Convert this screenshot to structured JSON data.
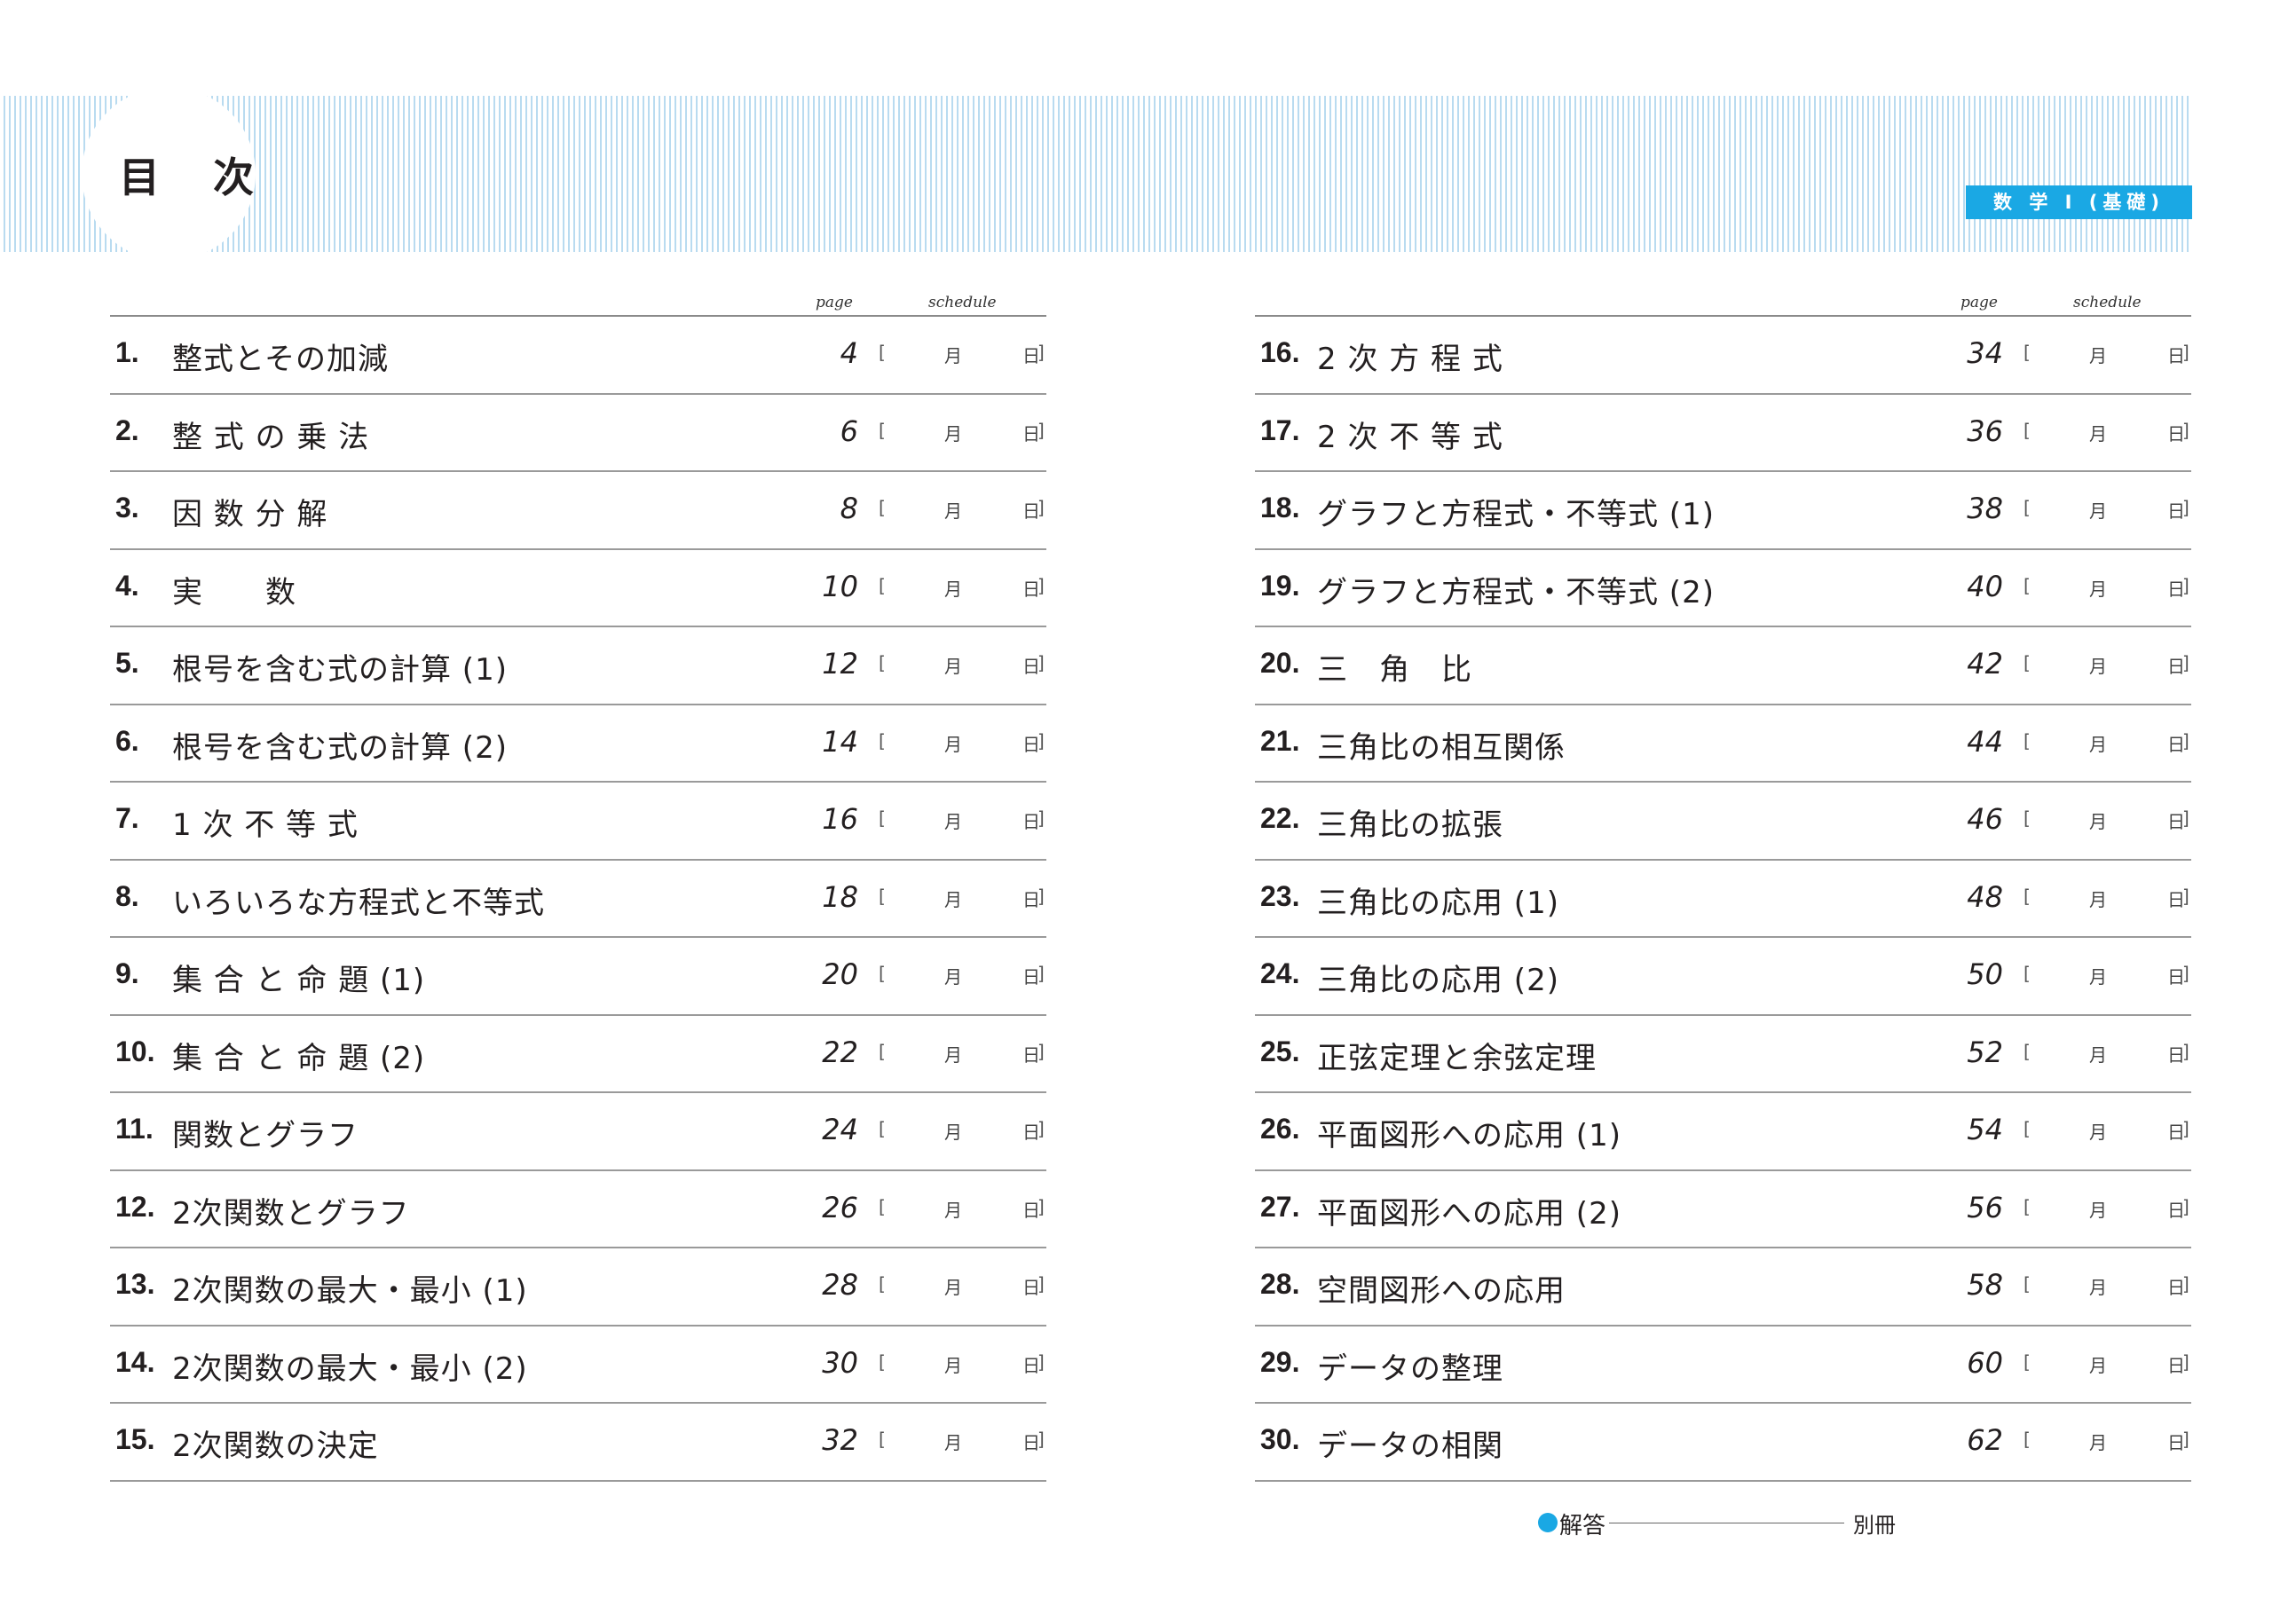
{
  "page_title": "目 次",
  "subject_badge": "数 学 I (基礎)",
  "headers": {
    "page": "page",
    "schedule": "schedule"
  },
  "schedule_labels": {
    "open": "[",
    "month": "月",
    "day": "日",
    "close": "]"
  },
  "left_items": [
    {
      "num": "1.",
      "title": "整式とその加減",
      "page": "4"
    },
    {
      "num": "2.",
      "title": "整 式 の 乗 法",
      "page": "6"
    },
    {
      "num": "3.",
      "title": "因 数 分 解",
      "page": "8"
    },
    {
      "num": "4.",
      "title": "実　　数",
      "page": "10"
    },
    {
      "num": "5.",
      "title": "根号を含む式の計算 (1)",
      "page": "12"
    },
    {
      "num": "6.",
      "title": "根号を含む式の計算 (2)",
      "page": "14"
    },
    {
      "num": "7.",
      "title": "1 次 不 等 式",
      "page": "16"
    },
    {
      "num": "8.",
      "title": "いろいろな方程式と不等式",
      "page": "18"
    },
    {
      "num": "9.",
      "title": "集 合 と 命 題 (1)",
      "page": "20"
    },
    {
      "num": "10.",
      "title": "集 合 と 命 題 (2)",
      "page": "22"
    },
    {
      "num": "11.",
      "title": "関数とグラフ",
      "page": "24"
    },
    {
      "num": "12.",
      "title": "2次関数とグラフ",
      "page": "26"
    },
    {
      "num": "13.",
      "title": "2次関数の最大・最小 (1)",
      "page": "28"
    },
    {
      "num": "14.",
      "title": "2次関数の最大・最小 (2)",
      "page": "30"
    },
    {
      "num": "15.",
      "title": "2次関数の決定",
      "page": "32"
    }
  ],
  "right_items": [
    {
      "num": "16.",
      "title": "2 次 方 程 式",
      "page": "34"
    },
    {
      "num": "17.",
      "title": "2 次 不 等 式",
      "page": "36"
    },
    {
      "num": "18.",
      "title": "グラフと方程式・不等式 (1)",
      "page": "38"
    },
    {
      "num": "19.",
      "title": "グラフと方程式・不等式 (2)",
      "page": "40"
    },
    {
      "num": "20.",
      "title": "三　角　比",
      "page": "42"
    },
    {
      "num": "21.",
      "title": "三角比の相互関係",
      "page": "44"
    },
    {
      "num": "22.",
      "title": "三角比の拡張",
      "page": "46"
    },
    {
      "num": "23.",
      "title": "三角比の応用 (1)",
      "page": "48"
    },
    {
      "num": "24.",
      "title": "三角比の応用 (2)",
      "page": "50"
    },
    {
      "num": "25.",
      "title": "正弦定理と余弦定理",
      "page": "52"
    },
    {
      "num": "26.",
      "title": "平面図形への応用 (1)",
      "page": "54"
    },
    {
      "num": "27.",
      "title": "平面図形への応用 (2)",
      "page": "56"
    },
    {
      "num": "28.",
      "title": "空間図形への応用",
      "page": "58"
    },
    {
      "num": "29.",
      "title": "データの整理",
      "page": "60"
    },
    {
      "num": "30.",
      "title": "データの相関",
      "page": "62"
    }
  ],
  "answers": {
    "label": "解答",
    "value": "別冊"
  }
}
